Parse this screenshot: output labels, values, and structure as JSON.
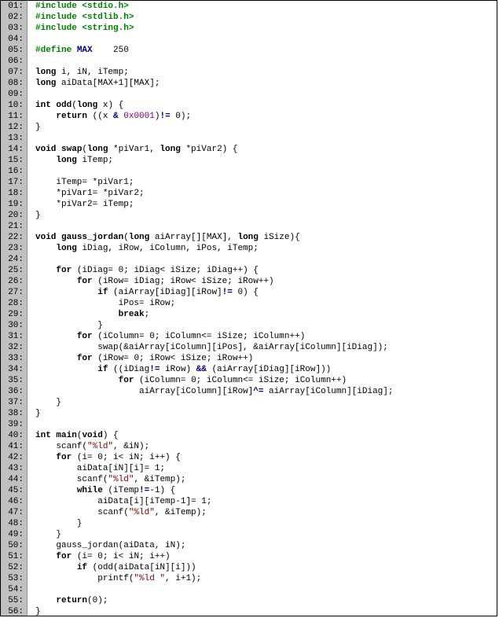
{
  "lines": [
    {
      "num": "01:",
      "html": "<span class='pp'>#include &lt;stdio.h&gt;</span>"
    },
    {
      "num": "02:",
      "html": "<span class='pp'>#include &lt;stdlib.h&gt;</span>"
    },
    {
      "num": "03:",
      "html": "<span class='pp'>#include &lt;string.h&gt;</span>"
    },
    {
      "num": "04:",
      "html": ""
    },
    {
      "num": "05:",
      "html": "<span class='pp'>#define </span><span class='n'>MAX</span>    <span class='num'>250</span>"
    },
    {
      "num": "06:",
      "html": ""
    },
    {
      "num": "07:",
      "html": "<span class='t'>long</span> i, iN, iTemp;"
    },
    {
      "num": "08:",
      "html": "<span class='t'>long</span> aiData[MAX+<span class='num'>1</span>][MAX];"
    },
    {
      "num": "09:",
      "html": ""
    },
    {
      "num": "10:",
      "html": "<span class='t'>int</span> <span class='fn'>odd</span>(<span class='t'>long</span> x) {"
    },
    {
      "num": "11:",
      "html": "    <span class='k'>return</span> ((x <span class='op'>&amp;</span> <span class='m'>0x0001</span>)<span class='op'>!=</span> <span class='num'>0</span>);"
    },
    {
      "num": "12:",
      "html": "}"
    },
    {
      "num": "13:",
      "html": ""
    },
    {
      "num": "14:",
      "html": "<span class='t'>void</span> <span class='fn'>swap</span>(<span class='t'>long</span> *piVar1, <span class='t'>long</span> *piVar2) {"
    },
    {
      "num": "15:",
      "html": "    <span class='t'>long</span> iTemp;"
    },
    {
      "num": "16:",
      "html": ""
    },
    {
      "num": "17:",
      "html": "    iTemp= *piVar1;"
    },
    {
      "num": "18:",
      "html": "    *piVar1= *piVar2;"
    },
    {
      "num": "19:",
      "html": "    *piVar2= iTemp;"
    },
    {
      "num": "20:",
      "html": "}"
    },
    {
      "num": "21:",
      "html": ""
    },
    {
      "num": "22:",
      "html": "<span class='t'>void</span> <span class='fn'>gauss_jordan</span>(<span class='t'>long</span> aiArray[][MAX], <span class='t'>long</span> iSize){"
    },
    {
      "num": "23:",
      "html": "    <span class='t'>long</span> iDiag, iRow, iColumn, iPos, iTemp;"
    },
    {
      "num": "24:",
      "html": ""
    },
    {
      "num": "25:",
      "html": "    <span class='k'>for</span> (iDiag= <span class='num'>0</span>; iDiag&lt; iSize; iDiag++) {"
    },
    {
      "num": "26:",
      "html": "        <span class='k'>for</span> (iRow= iDiag; iRow&lt; iSize; iRow++)"
    },
    {
      "num": "27:",
      "html": "            <span class='k'>if</span> (aiArray[iDiag][iRow]<span class='op'>!=</span> <span class='num'>0</span>) {"
    },
    {
      "num": "28:",
      "html": "                iPos= iRow;"
    },
    {
      "num": "29:",
      "html": "                <span class='k'>break</span>;"
    },
    {
      "num": "30:",
      "html": "            }"
    },
    {
      "num": "31:",
      "html": "        <span class='k'>for</span> (iColumn= <span class='num'>0</span>; iColumn&lt;= iSize; iColumn++)"
    },
    {
      "num": "32:",
      "html": "            swap(&amp;aiArray[iColumn][iPos], &amp;aiArray[iColumn][iDiag]);"
    },
    {
      "num": "33:",
      "html": "        <span class='k'>for</span> (iRow= <span class='num'>0</span>; iRow&lt; iSize; iRow++)"
    },
    {
      "num": "34:",
      "html": "            <span class='k'>if</span> ((iDiag<span class='op'>!=</span> iRow) <span class='op'>&amp;&amp;</span> (aiArray[iDiag][iRow]))"
    },
    {
      "num": "35:",
      "html": "                <span class='k'>for</span> (iColumn= <span class='num'>0</span>; iColumn&lt;= iSize; iColumn++)"
    },
    {
      "num": "36:",
      "html": "                    aiArray[iColumn][iRow]<span class='op'>^=</span> aiArray[iColumn][iDiag];"
    },
    {
      "num": "37:",
      "html": "    }"
    },
    {
      "num": "38:",
      "html": "}"
    },
    {
      "num": "39:",
      "html": ""
    },
    {
      "num": "40:",
      "html": "<span class='t'>int</span> <span class='fn'>main</span>(<span class='t'>void</span>) {"
    },
    {
      "num": "41:",
      "html": "    scanf(<span class='s'>\"%ld\"</span>, &amp;iN);"
    },
    {
      "num": "42:",
      "html": "    <span class='k'>for</span> (i= <span class='num'>0</span>; i&lt; iN; i++) {"
    },
    {
      "num": "43:",
      "html": "        aiData[iN][i]= <span class='num'>1</span>;"
    },
    {
      "num": "44:",
      "html": "        scanf(<span class='s'>\"%ld\"</span>, &amp;iTemp);"
    },
    {
      "num": "45:",
      "html": "        <span class='k'>while</span> (iTemp<span class='op'>!=</span>-<span class='num'>1</span>) {"
    },
    {
      "num": "46:",
      "html": "            aiData[i][iTemp-<span class='num'>1</span>]= <span class='num'>1</span>;"
    },
    {
      "num": "47:",
      "html": "            scanf(<span class='s'>\"%ld\"</span>, &amp;iTemp);"
    },
    {
      "num": "48:",
      "html": "        }"
    },
    {
      "num": "49:",
      "html": "    }"
    },
    {
      "num": "50:",
      "html": "    gauss_jordan(aiData, iN);"
    },
    {
      "num": "51:",
      "html": "    <span class='k'>for</span> (i= <span class='num'>0</span>; i&lt; iN; i++)"
    },
    {
      "num": "52:",
      "html": "        <span class='k'>if</span> (odd(aiData[iN][i]))"
    },
    {
      "num": "53:",
      "html": "            printf(<span class='s'>\"%ld \"</span>, i+<span class='num'>1</span>);"
    },
    {
      "num": "54:",
      "html": ""
    },
    {
      "num": "55:",
      "html": "    <span class='k'>return</span>(<span class='num'>0</span>);"
    },
    {
      "num": "56:",
      "html": "}"
    }
  ]
}
